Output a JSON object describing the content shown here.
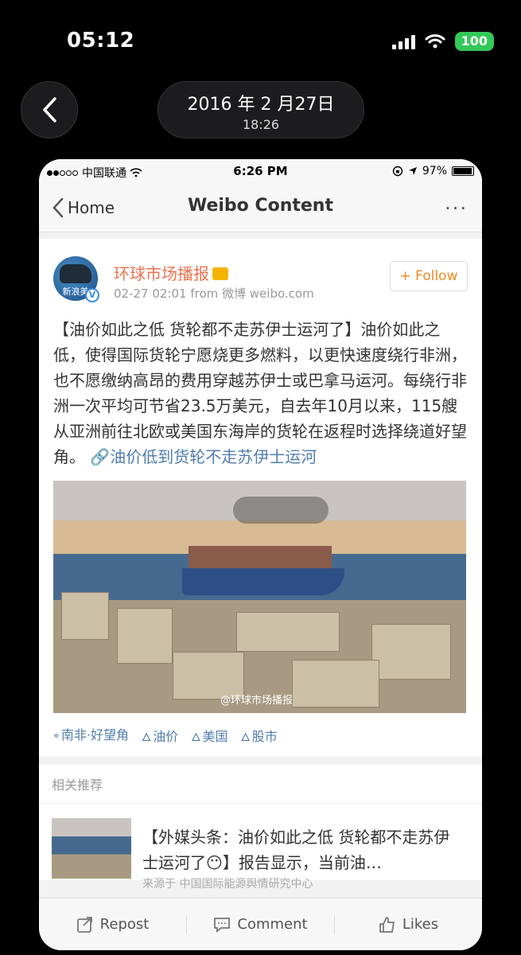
{
  "outer_status": {
    "time": "05:12",
    "battery": "100"
  },
  "date_header": {
    "date": "2016 年 2 月27日",
    "time": "18:26"
  },
  "inner_status": {
    "carrier": "中国联通",
    "time": "6:26 PM",
    "battery": "97%"
  },
  "nav": {
    "back_label": "Home",
    "title": "Weibo Content",
    "more": "···"
  },
  "post": {
    "avatar_label": "新浪美",
    "author": "环球市场播报",
    "meta": "02-27 02:01   from 微博 weibo.com",
    "follow_label": "+ Follow",
    "text": "【油价如此之低 货轮都不走苏伊士运河了】油价如此之低，使得国际货轮宁愿烧更多燃料，以更快速度绕行非洲，也不愿缴纳高昂的费用穿越苏伊士或巴拿马运河。每绕行非洲一次平均可节省23.5万美元，自去年10月以来，115艘从亚洲前往北欧或美国东海岸的货轮在返程时选择绕道好望角。",
    "link_text": "油价低到货轮不走苏伊士运河",
    "image_watermark": "@环球市场播报",
    "tags": [
      "南非·好望角",
      "油价",
      "美国",
      "股市"
    ]
  },
  "related": {
    "section_label": "相关推荐",
    "title": "【外媒头条：油价如此之低 货轮都不走苏伊士运河了😶】报告显示，当前油…",
    "sub": "来源于 中国国际能源舆情研究中心"
  },
  "actions": {
    "repost": "Repost",
    "comment": "Comment",
    "likes": "Likes"
  }
}
